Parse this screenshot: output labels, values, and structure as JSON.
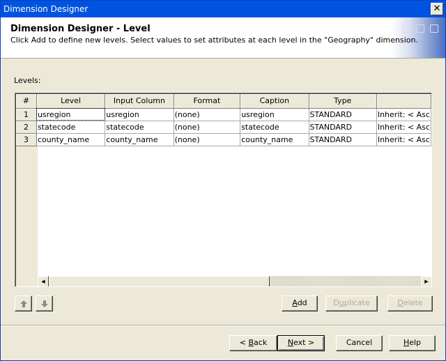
{
  "window": {
    "title": "Dimension Designer",
    "close_glyph": "✕"
  },
  "header": {
    "title": "Dimension Designer - Level",
    "description": "Click Add to define new levels. Select values to set attributes at each level in the \"Geography\" dimension."
  },
  "levels": {
    "label": "Levels:",
    "columns": [
      "#",
      "Level",
      "Input Column",
      "Format",
      "Caption",
      "Type",
      ""
    ],
    "rows": [
      {
        "num": "1",
        "level": "usregion",
        "input_column": "usregion",
        "format": "(none)",
        "caption": "usregion",
        "type": "STANDARD",
        "extra": "Inherit: < Asc"
      },
      {
        "num": "2",
        "level": "statecode",
        "input_column": "statecode",
        "format": "(none)",
        "caption": "statecode",
        "type": "STANDARD",
        "extra": "Inherit: < Asc"
      },
      {
        "num": "3",
        "level": "county_name",
        "input_column": "county_name",
        "format": "(none)",
        "caption": "county_name",
        "type": "STANDARD",
        "extra": "Inherit: < Asc"
      }
    ],
    "scroll_left_glyph": "◀",
    "scroll_right_glyph": "▶"
  },
  "actions": {
    "move_up": "arrow-up-icon",
    "move_down": "arrow-down-icon",
    "add": {
      "pre": "",
      "key": "A",
      "post": "dd"
    },
    "duplicate": {
      "pre": "D",
      "key": "u",
      "post": "plicate"
    },
    "delete": {
      "pre": "",
      "key": "D",
      "post": "elete"
    }
  },
  "footer": {
    "back": {
      "pre": "< ",
      "key": "B",
      "post": "ack"
    },
    "next": {
      "pre": "",
      "key": "N",
      "post": "ext >"
    },
    "cancel": "Cancel",
    "help": {
      "pre": "",
      "key": "H",
      "post": "elp"
    }
  }
}
